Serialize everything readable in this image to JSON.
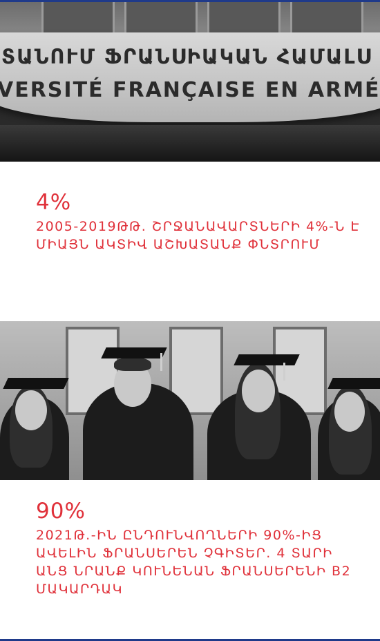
{
  "photo_1": {
    "sign_armenian": "ՏԱՆՈՒՄ ՖՐԱՆՍԻԱԿԱՆ ՀԱՄԱԼՍ",
    "sign_french": "VERSITÉ FRANÇAISE EN ARMÉN"
  },
  "stats": [
    {
      "value": "4%",
      "text": "2005-2019ԹԹ. ՇՐՋԱՆԱՎԱՐՏՆԵՐԻ 4%-Ն Է ՄԻԱՅՆ ԱԿՏԻՎ ԱՇԽԱՏԱՆՔ ՓՆՏՐՈՒՄ"
    },
    {
      "value": "90%",
      "text": "2021Թ.-ԻՆ ԸՆԴՈՒՆՎՈՂՆԵՐԻ 90%-ԻՑ ԱՎԵԼԻՆ ՖՐԱՆՍԵՐԵՆ ՉԳԻՏԵՐ. 4 ՏԱՐԻ ԱՆՑ ՆՐԱՆՔ ԿՈՒՆԵՆԱՆ ՖՐԱՆՍԵՐԵՆԻ B2 ՄԱԿԱՐԴԱԿ"
    }
  ],
  "colors": {
    "accent": "#e0313a",
    "stripe": "#1f3a8a"
  }
}
